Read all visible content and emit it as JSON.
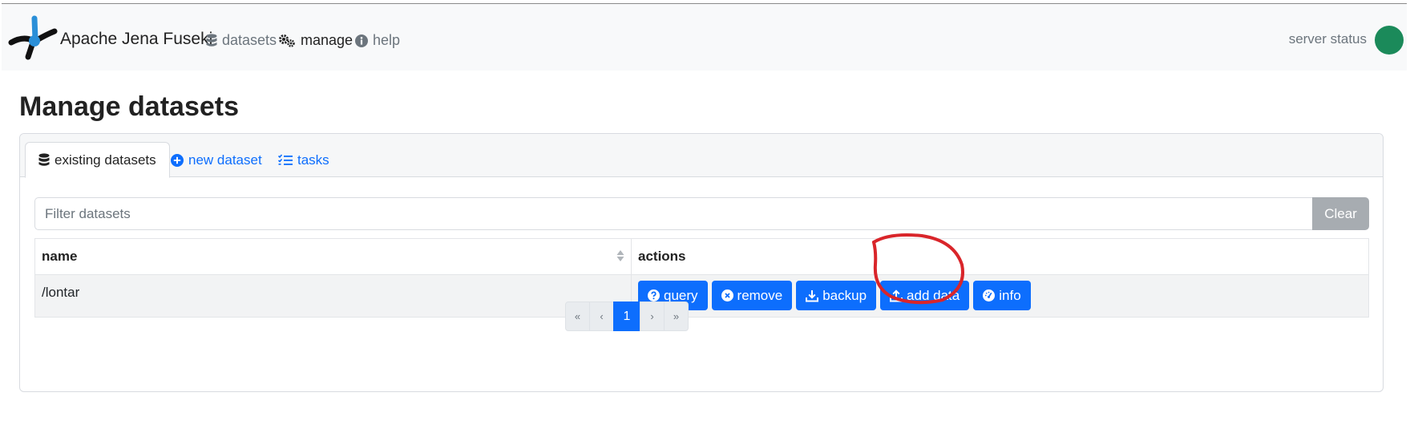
{
  "navbar": {
    "brand": "Apache Jena Fuseki",
    "links": [
      {
        "label": "datasets",
        "icon": "database-icon"
      },
      {
        "label": "manage",
        "icon": "gears-icon"
      },
      {
        "label": "help",
        "icon": "info-icon"
      }
    ],
    "status_label": "server status",
    "status_color": "#1b8a5a"
  },
  "page": {
    "title": "Manage datasets"
  },
  "tabs": [
    {
      "label": "existing datasets",
      "icon": "database-icon"
    },
    {
      "label": "new dataset",
      "icon": "plus-circle-icon"
    },
    {
      "label": "tasks",
      "icon": "task-list-icon"
    }
  ],
  "filter": {
    "placeholder": "Filter datasets",
    "value": "",
    "clear_label": "Clear"
  },
  "table": {
    "headers": {
      "name": "name",
      "actions": "actions"
    },
    "rows": [
      {
        "name": "/lontar"
      }
    ]
  },
  "actions": {
    "query": "query",
    "remove": "remove",
    "backup": "backup",
    "add_data": "add data",
    "info": "info"
  },
  "pagination": {
    "first": "«",
    "prev": "‹",
    "current": "1",
    "next": "›",
    "last": "»"
  },
  "colors": {
    "primary": "#0d6efd",
    "annotation": "#d9252a",
    "clear_button": "#a7acb1"
  }
}
